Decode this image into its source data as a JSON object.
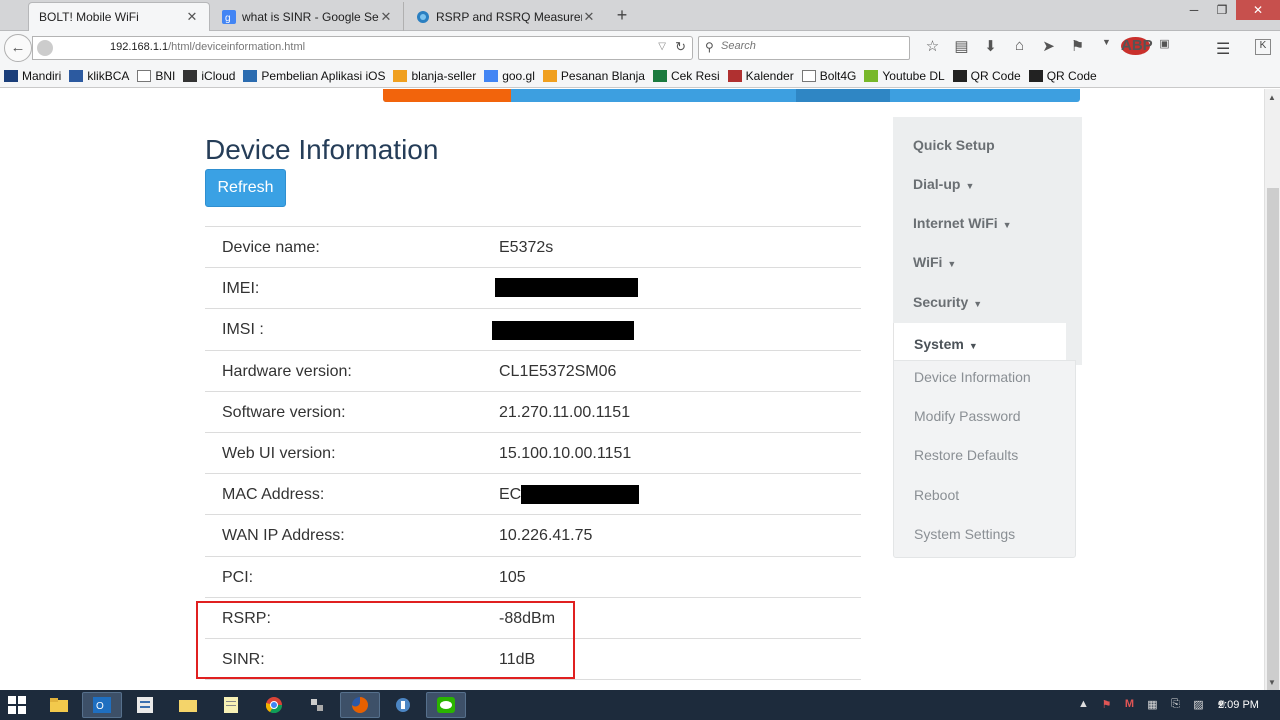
{
  "browser": {
    "tabs": [
      {
        "title": "BOLT! Mobile WiFi",
        "favicon": "blank-page-icon",
        "active": true
      },
      {
        "title": "what is SINR - Google Search",
        "favicon": "google-icon",
        "active": false
      },
      {
        "title": "RSRP and RSRQ Measurem...",
        "favicon": "globe-icon",
        "active": false
      }
    ],
    "new_tab": "+",
    "url_host": "192.168.1.1",
    "url_path": "/html/deviceinformation.html",
    "search_placeholder": "Search",
    "extension_k": "K",
    "bookmarks": [
      {
        "label": "Mandiri",
        "icon": "mandiri-icon"
      },
      {
        "label": "klikBCA",
        "icon": "bca-icon"
      },
      {
        "label": "BNI",
        "icon": "page-icon"
      },
      {
        "label": "iCloud",
        "icon": "apple-icon"
      },
      {
        "label": "Pembelian Aplikasi iOS",
        "icon": "k-icon"
      },
      {
        "label": "blanja-seller",
        "icon": "check-icon"
      },
      {
        "label": "goo.gl",
        "icon": "google-icon"
      },
      {
        "label": "Pesanan Blanja",
        "icon": "check-icon"
      },
      {
        "label": "Cek Resi",
        "icon": "flag-icon"
      },
      {
        "label": "Kalender",
        "icon": "calendar-icon"
      },
      {
        "label": "Bolt4G",
        "icon": "page-icon"
      },
      {
        "label": "Youtube DL",
        "icon": "download-icon"
      },
      {
        "label": "QR Code",
        "icon": "qr-icon"
      },
      {
        "label": "QR Code",
        "icon": "qr-icon"
      }
    ]
  },
  "page": {
    "title": "Device Information",
    "refresh_label": "Refresh",
    "rows": [
      {
        "label": "Device name:",
        "value": "E5372s"
      },
      {
        "label": "IMEI:",
        "value": ""
      },
      {
        "label": "IMSI :",
        "value": ""
      },
      {
        "label": "Hardware version:",
        "value": "CL1E5372SM06"
      },
      {
        "label": "Software version:",
        "value": "21.270.11.00.1151"
      },
      {
        "label": "Web UI version:",
        "value": "15.100.10.00.1151"
      },
      {
        "label": "MAC Address:",
        "value": "EC"
      },
      {
        "label": "WAN IP Address:",
        "value": "10.226.41.75"
      },
      {
        "label": "PCI:",
        "value": "105"
      },
      {
        "label": "RSRP:",
        "value": "-88dBm"
      },
      {
        "label": "SINR:",
        "value": "11dB"
      }
    ],
    "highlight_color": "#e02020"
  },
  "sidebar": {
    "items": [
      {
        "label": "Quick Setup",
        "caret": false
      },
      {
        "label": "Dial-up",
        "caret": true
      },
      {
        "label": "Internet WiFi",
        "caret": true
      },
      {
        "label": "WiFi",
        "caret": true
      },
      {
        "label": "Security",
        "caret": true
      },
      {
        "label": "System",
        "caret": true
      }
    ],
    "submenu": [
      "Device Information",
      "Modify Password",
      "Restore Defaults",
      "Reboot",
      "System Settings"
    ]
  },
  "taskbar": {
    "apps": [
      "file-explorer-icon",
      "outlook-icon",
      "notes-icon",
      "folder-icon",
      "notepad-icon",
      "chrome-icon",
      "network-tool-icon",
      "firefox-icon",
      "bitvise-icon",
      "line-icon"
    ],
    "clock": "2:09 PM"
  },
  "colors": {
    "accent_blue": "#3aa1e4",
    "accent_orange": "#f2640c",
    "title_navy": "#253d58"
  }
}
